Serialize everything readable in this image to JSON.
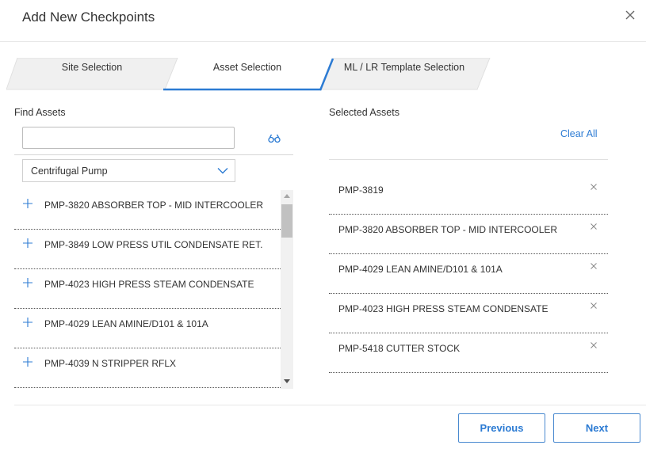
{
  "dialog": {
    "title": "Add New Checkpoints"
  },
  "tabs": [
    {
      "label": "Site Selection",
      "active": false
    },
    {
      "label": "Asset Selection",
      "active": true
    },
    {
      "label": "ML / LR Template Selection",
      "active": false
    }
  ],
  "find_assets": {
    "label": "Find Assets",
    "search_value": "",
    "search_placeholder": "",
    "filter_selected": "Centrifugal Pump",
    "results": [
      {
        "label": "PMP-3820 ABSORBER TOP - MID INTERCOOLER"
      },
      {
        "label": "PMP-3849 LOW PRESS UTIL CONDENSATE RET."
      },
      {
        "label": "PMP-4023 HIGH PRESS STEAM CONDENSATE"
      },
      {
        "label": "PMP-4029 LEAN AMINE/D101 & 101A"
      },
      {
        "label": "PMP-4039 N STRIPPER RFLX"
      }
    ]
  },
  "selected_assets": {
    "label": "Selected Assets",
    "clear_all_label": "Clear All",
    "items": [
      {
        "label": "PMP-3819"
      },
      {
        "label": "PMP-3820 ABSORBER TOP - MID INTERCOOLER"
      },
      {
        "label": "PMP-4029 LEAN AMINE/D101 & 101A"
      },
      {
        "label": "PMP-4023 HIGH PRESS STEAM CONDENSATE"
      },
      {
        "label": "PMP-5418 CUTTER STOCK"
      }
    ]
  },
  "footer": {
    "previous_label": "Previous",
    "next_label": "Next"
  },
  "colors": {
    "accent": "#2c7bd3",
    "tab_inactive": "#f0f0f0",
    "border": "#d0d0d0"
  }
}
